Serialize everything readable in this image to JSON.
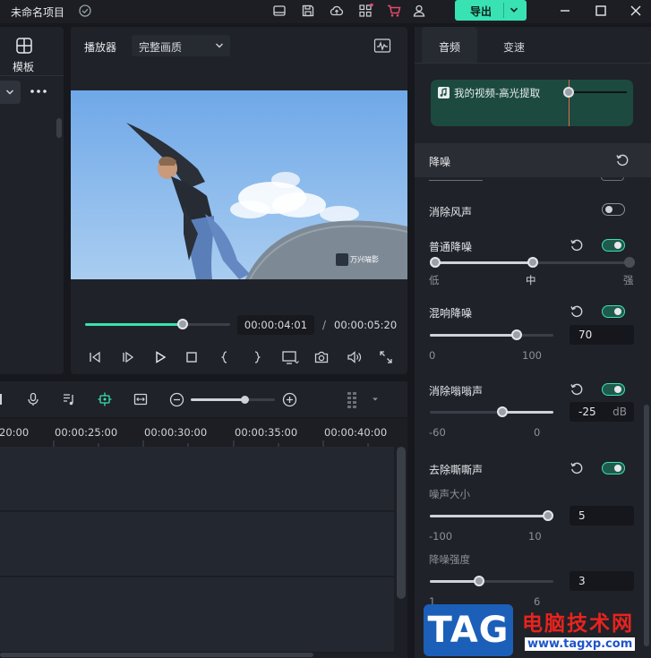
{
  "app": {
    "project_title": "未命名项目",
    "export_label": "导出"
  },
  "left_panel": {
    "tab_label": "模板"
  },
  "player": {
    "title": "播放器",
    "quality": "完整画质",
    "video_watermark": "万兴喵影",
    "progress": 0.67,
    "time_current": "00:00:04:01",
    "time_separator": "/",
    "time_total": "00:00:05:20"
  },
  "timeline": {
    "zoom_level": 0.64,
    "ruler_labels": [
      "20:00",
      "00:00:25:00",
      "00:00:30:00",
      "00:00:35:00",
      "00:00:40:00"
    ]
  },
  "right_panel": {
    "tabs": [
      "音频",
      "变速"
    ],
    "active_tab": "音频",
    "clip_name": "我的视频-高光提取",
    "section_title": "降噪",
    "wind": {
      "label": "消除风声",
      "enabled": false
    },
    "normal_denoise": {
      "label": "普通降噪",
      "enabled": true,
      "level": 0.5,
      "ticks": [
        "低",
        "中",
        "强"
      ]
    },
    "reverb": {
      "label": "混响降噪",
      "enabled": true,
      "value": "70",
      "min": "0",
      "max": "100"
    },
    "hum": {
      "label": "消除嗡嗡声",
      "enabled": true,
      "value": "-25",
      "unit": "dB",
      "min": "-60",
      "max": "0"
    },
    "hiss": {
      "label": "去除嘶嘶声",
      "enabled": true,
      "noise_size": {
        "label": "噪声大小",
        "value": "5",
        "min": "-100",
        "max": "10"
      },
      "strength": {
        "label": "降噪强度",
        "value": "3",
        "min": "1",
        "max": "6"
      }
    }
  },
  "watermark": {
    "logo": "TAG",
    "site_name": "电脑技术网",
    "url": "www.tagxp.com"
  },
  "colors": {
    "accent": "#38e2b3",
    "panel": "#1f2228",
    "background": "#16181d",
    "clip_card": "#1c4a3f"
  }
}
